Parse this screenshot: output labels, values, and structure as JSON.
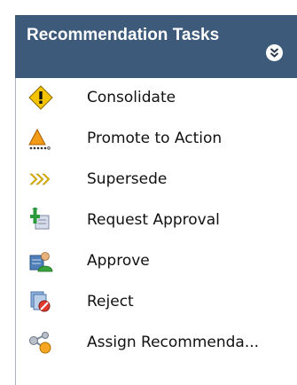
{
  "panel": {
    "title": "Recommendation Tasks",
    "collapse_icon": "double-chevron-down-icon",
    "colors": {
      "header_bg": "#3e5a7b",
      "header_text": "#ffffff"
    }
  },
  "tasks": [
    {
      "label": "Consolidate",
      "icon": "consolidate-icon"
    },
    {
      "label": "Promote to Action",
      "icon": "promote-icon"
    },
    {
      "label": "Supersede",
      "icon": "supersede-icon"
    },
    {
      "label": "Request Approval",
      "icon": "request-approval-icon"
    },
    {
      "label": "Approve",
      "icon": "approve-icon"
    },
    {
      "label": "Reject",
      "icon": "reject-icon"
    },
    {
      "label": "Assign Recommenda...",
      "icon": "assign-icon"
    }
  ]
}
